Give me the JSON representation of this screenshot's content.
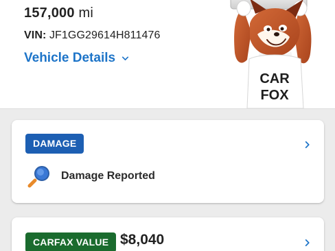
{
  "vehicle": {
    "mileage_value": "157,000",
    "mileage_unit": "mi",
    "vin_label": "VIN:",
    "vin_value": "JF1GG29614H811476",
    "details_label": "Vehicle Details",
    "details_icon": "chevron-down-icon"
  },
  "mascot": {
    "shirt_line1": "CAR",
    "shirt_line2": "FOX"
  },
  "cards": {
    "damage": {
      "badge": "DAMAGE",
      "badge_color": "#1d5fb3",
      "icon": "magnifier-icon",
      "text": "Damage Reported",
      "chevron_icon": "chevron-right-icon"
    },
    "value": {
      "badge": "CARFAX VALUE",
      "badge_color": "#1a6b2e",
      "amount": "$8,040",
      "chevron_icon": "chevron-right-icon"
    }
  },
  "colors": {
    "link_blue": "#1d74c8",
    "background": "#ececec",
    "card_background": "#ffffff"
  }
}
